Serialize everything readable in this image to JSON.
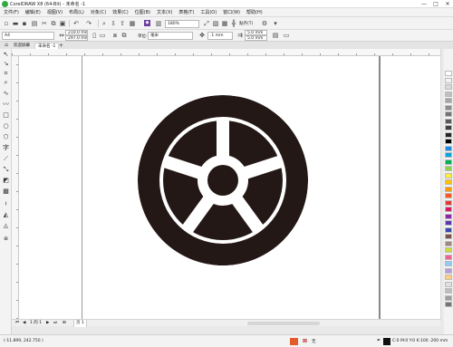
{
  "window": {
    "title": "CorelDRAW X8 (64-Bit) - 未命名 -1",
    "minimize": "—",
    "maximize": "□",
    "close": "✕"
  },
  "menu": [
    "文件(F)",
    "编辑(E)",
    "视图(V)",
    "布局(L)",
    "对象(C)",
    "效果(C)",
    "位图(B)",
    "文本(X)",
    "表格(T)",
    "工具(O)",
    "窗口(W)",
    "帮助(H)"
  ],
  "toolbar": {
    "zoom": "180%",
    "snap_to": "贴齐(T)",
    "page_size": "A4",
    "width": "210.0 mm",
    "height": "297.0 mm",
    "units_label": "单位:",
    "units_value": "毫米",
    "nudge": ".1 mm",
    "dup_x": "5.0 mm",
    "dup_y": "5.0 mm"
  },
  "tabs": {
    "welcome": "欢迎屏幕",
    "document": "未命名 -1"
  },
  "pagenav": {
    "page_count": "1 的 1",
    "page_tab": "页 1"
  },
  "status": {
    "coords": "(-11.899, 242.750 )",
    "fill_label": "无",
    "color_info": "C:0 M:0 Y:0 K:100 .200 mm"
  },
  "colors": {
    "accent": "#36a842",
    "artwork": "#231815",
    "palette": [
      "#ffffff",
      "#f2f2f2",
      "#d9d9d9",
      "#bfbfbf",
      "#a6a6a6",
      "#8c8c8c",
      "#737373",
      "#595959",
      "#404040",
      "#262626",
      "#000000",
      "#1e88e5",
      "#00a3e0",
      "#00b050",
      "#92d050",
      "#ffeb3b",
      "#ffc000",
      "#ff9800",
      "#ff5722",
      "#e53935",
      "#d81b60",
      "#8e24aa",
      "#5e35b1",
      "#3949ab",
      "#795548",
      "#a1887f",
      "#cddc39",
      "#f06292",
      "#90caf9",
      "#b39ddb",
      "#ffcc80",
      "#e0e0e0",
      "#bdbdbd",
      "#9e9e9e",
      "#757575"
    ]
  }
}
